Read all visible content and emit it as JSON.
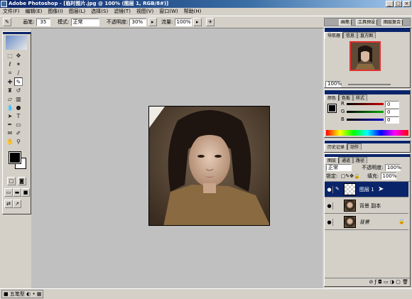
{
  "window": {
    "title": "Adobe Photoshop - [临时图片.jpg @ 100% (图层 1, RGB/8#)]"
  },
  "menu": [
    "文件(F)",
    "编辑(E)",
    "图像(I)",
    "图层(L)",
    "选择(S)",
    "滤镜(T)",
    "视图(V)",
    "窗口(W)",
    "帮助(H)"
  ],
  "options": {
    "brush_label": "画笔:",
    "brush_size": "35",
    "mode_label": "模式:",
    "mode_value": "正常",
    "opacity_label": "不透明度:",
    "opacity_value": "30%",
    "flow_label": "流量:",
    "flow_value": "100%"
  },
  "palette_well": [
    "画笔",
    "工具预设",
    "图层复合"
  ],
  "navigator": {
    "tabs": [
      "导航器",
      "信息",
      "直方图"
    ],
    "zoom": "100%"
  },
  "color": {
    "tabs": [
      "颜色",
      "色板",
      "样式"
    ],
    "rows": [
      {
        "label": "R",
        "value": "0"
      },
      {
        "label": "G",
        "value": "0"
      },
      {
        "label": "B",
        "value": "0"
      }
    ],
    "bar_colors": {
      "R": "#cc0000",
      "G": "#00aa00",
      "B": "#0000cc"
    }
  },
  "history": {
    "tabs": [
      "历史记录",
      "动作"
    ]
  },
  "layers": {
    "tabs": [
      "图层",
      "通道",
      "路径"
    ],
    "blend_mode": "正常",
    "opacity_label": "不透明度:",
    "opacity_value": "100%",
    "lock_label": "锁定:",
    "fill_label": "填充:",
    "fill_value": "100%",
    "items": [
      {
        "name": "图层 1",
        "selected": true
      },
      {
        "name": "背景 副本",
        "selected": false
      },
      {
        "name": "背景",
        "selected": false
      }
    ]
  },
  "taskbar": {
    "label": "五笔型"
  },
  "icons": [
    "photoshop-logo-icon",
    "minimize-icon",
    "maximize-icon",
    "close-icon",
    "eye-icon",
    "brush-icon",
    "lock-icon",
    "trash-icon"
  ]
}
